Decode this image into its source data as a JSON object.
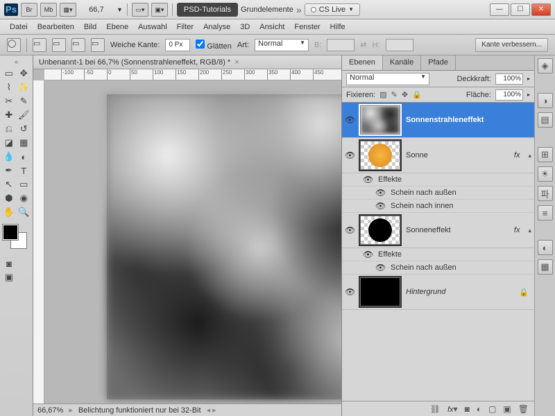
{
  "title": {
    "zoom": "66,7",
    "tut": "PSD-Tutorials",
    "grp": "Grundelemente",
    "cslive": "CS Live"
  },
  "menu": [
    "Datei",
    "Bearbeiten",
    "Bild",
    "Ebene",
    "Auswahl",
    "Filter",
    "Analyse",
    "3D",
    "Ansicht",
    "Fenster",
    "Hilfe"
  ],
  "options": {
    "weicheKante": "Weiche Kante:",
    "px": "0 Px",
    "glatten": "Glätten",
    "art": "Art:",
    "artVal": "Normal",
    "b": "B:",
    "h": "H:",
    "verbessern": "Kante verbessern..."
  },
  "doc": {
    "tab": "Unbenannt-1 bei 66,7% (Sonnenstrahleneffekt, RGB/8) *"
  },
  "status": {
    "zoom": "66,67%",
    "msg": "Belichtung funktioniert nur bei 32-Bit"
  },
  "panel": {
    "tabs": [
      "Ebenen",
      "Kanäle",
      "Pfade"
    ],
    "blend": "Normal",
    "deckkraft": "Deckkraft:",
    "deckVal": "100%",
    "fixieren": "Fixieren:",
    "flaeche": "Fläche:",
    "flVal": "100%",
    "layers": [
      {
        "name": "Sonnenstrahleneffekt",
        "sel": true,
        "type": "clouds"
      },
      {
        "name": "Sonne",
        "fx": true,
        "type": "sun",
        "effects": [
          "Effekte",
          "Schein nach außen",
          "Schein nach innen"
        ]
      },
      {
        "name": "Sonneneffekt",
        "fx": true,
        "type": "black",
        "effects": [
          "Effekte",
          "Schein nach außen"
        ]
      },
      {
        "name": "Hintergrund",
        "lock": true,
        "type": "solid",
        "italic": true
      }
    ],
    "fxLabel": "fx"
  },
  "ruler": [
    -100,
    -50,
    0,
    50,
    100,
    150,
    200,
    250,
    300,
    350,
    400,
    450
  ]
}
